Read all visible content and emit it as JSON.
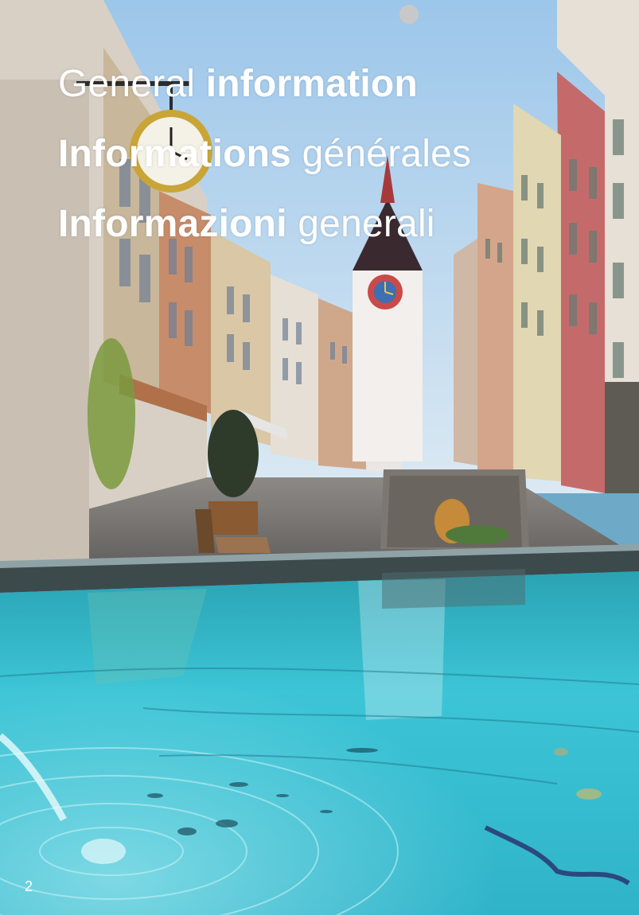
{
  "titles": {
    "en": {
      "light": "General",
      "bold": "information"
    },
    "fr": {
      "bold": "Informations",
      "light": "générales"
    },
    "it": {
      "bold": "Informazioni",
      "light": "generali"
    }
  },
  "page_number": "2",
  "colors": {
    "sky": "#b9d7ee",
    "water": "#35c3d3",
    "tower_roof": "#3a2a30",
    "text": "#ffffff"
  }
}
